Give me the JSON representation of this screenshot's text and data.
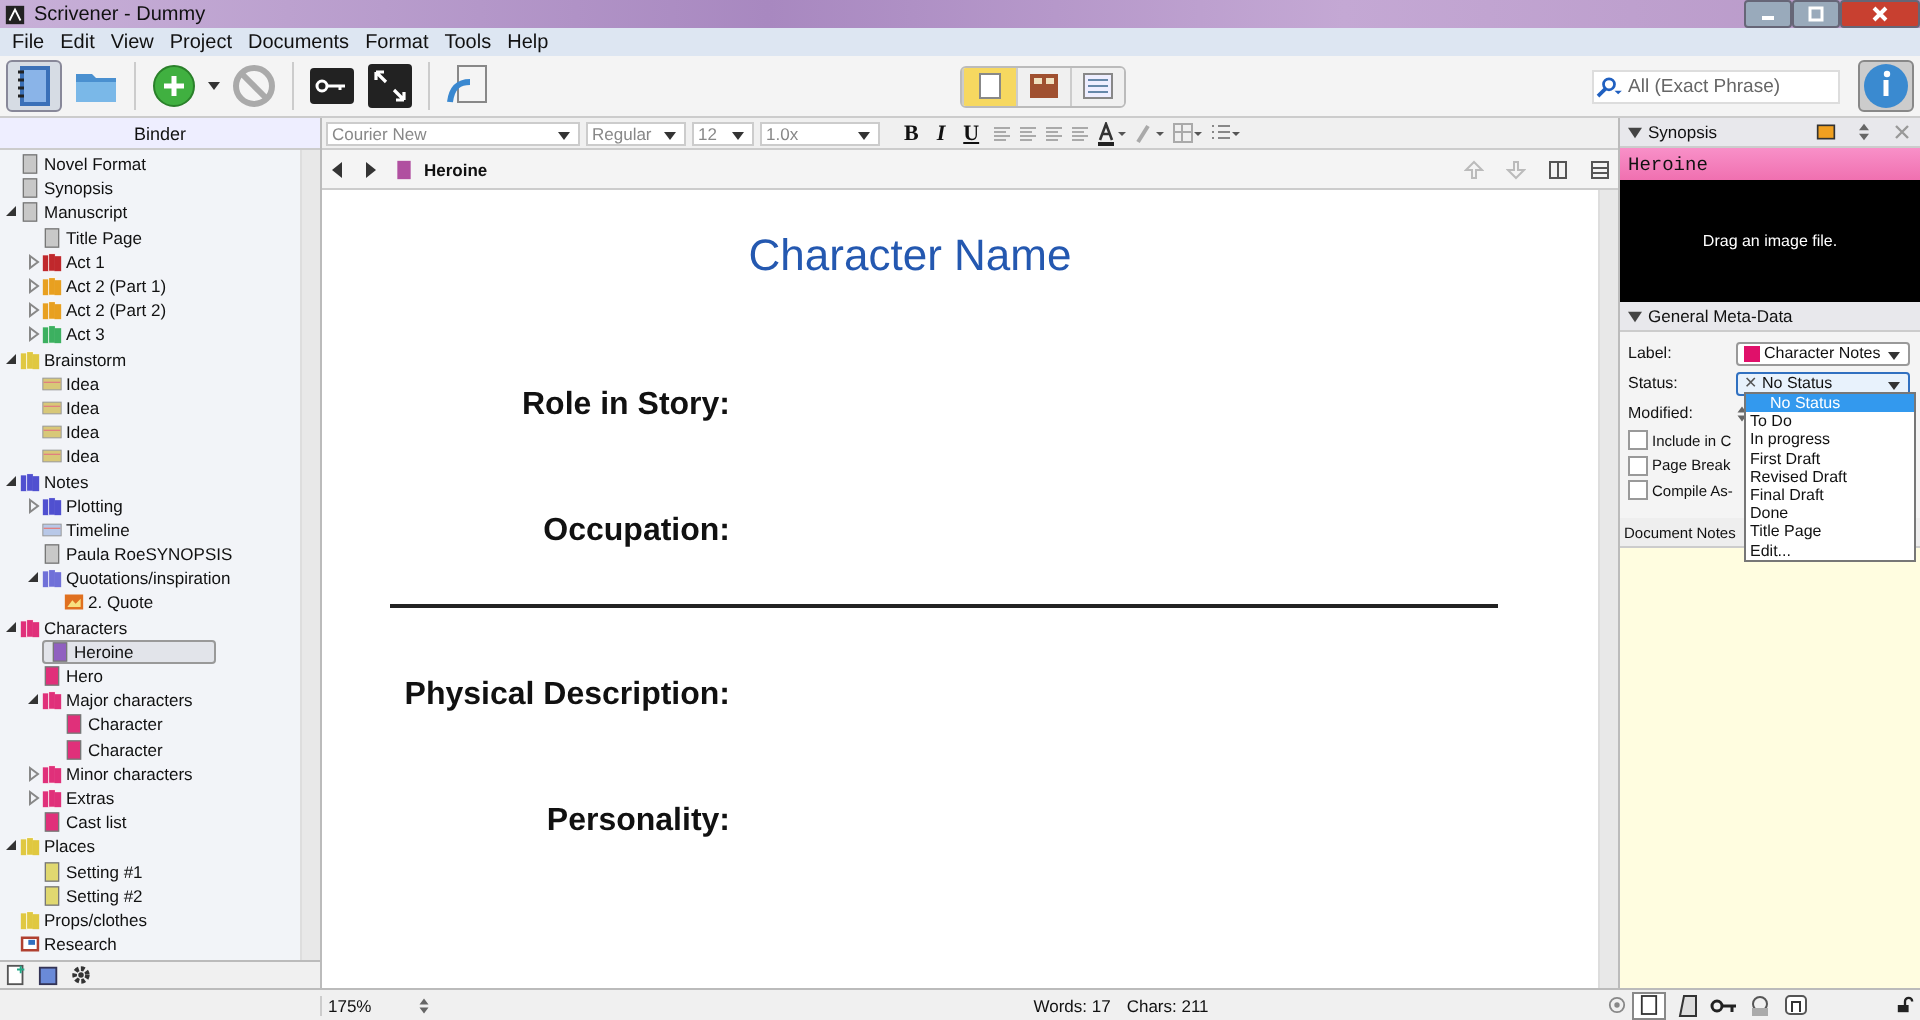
{
  "window": {
    "title": "Scrivener - Dummy"
  },
  "menu": [
    "File",
    "Edit",
    "View",
    "Project",
    "Documents",
    "Format",
    "Tools",
    "Help"
  ],
  "search": {
    "placeholder": "All (Exact Phrase)"
  },
  "view_modes": [
    {
      "selected": true
    },
    {
      "selected": false
    },
    {
      "selected": false
    }
  ],
  "format_bar": {
    "font": "Courier New",
    "style": "Regular",
    "size": "12",
    "spacing": "1.0x",
    "bold": "B",
    "italic": "I",
    "underline": "U"
  },
  "binder": {
    "title": "Binder",
    "items": [
      {
        "label": "Novel Format",
        "kind": "doc",
        "color": "#c8c8c8"
      },
      {
        "label": "Synopsis",
        "kind": "doc",
        "color": "#c8c8c8"
      },
      {
        "label": "Manuscript",
        "kind": "doc",
        "color": "#c8c8c8",
        "expanded": true,
        "children": [
          {
            "label": "Title Page",
            "kind": "doc",
            "color": "#c8c8c8"
          },
          {
            "label": "Act 1",
            "kind": "folder",
            "color": "#c0282c",
            "expanded": false
          },
          {
            "label": "Act 2 (Part 1)",
            "kind": "folder",
            "color": "#e8a020",
            "expanded": false
          },
          {
            "label": "Act 2 (Part 2)",
            "kind": "folder",
            "color": "#e8a020",
            "expanded": false
          },
          {
            "label": "Act 3",
            "kind": "folder",
            "color": "#3cb060",
            "expanded": false
          }
        ]
      },
      {
        "label": "Brainstorm",
        "kind": "folder",
        "color": "#e0c840",
        "expanded": true,
        "children": [
          {
            "label": "Idea",
            "kind": "card",
            "color": "#d8c878"
          },
          {
            "label": "Idea",
            "kind": "card",
            "color": "#d8c878"
          },
          {
            "label": "Idea",
            "kind": "card",
            "color": "#d8c878"
          },
          {
            "label": "Idea",
            "kind": "card",
            "color": "#d8c878"
          }
        ]
      },
      {
        "label": "Notes",
        "kind": "folder",
        "color": "#5050d0",
        "expanded": true,
        "children": [
          {
            "label": "Plotting",
            "kind": "folder",
            "color": "#5050d0",
            "expanded": false
          },
          {
            "label": "Timeline",
            "kind": "card",
            "color": "#b8c8e8"
          },
          {
            "label": "Paula RoeSYNOPSIS",
            "kind": "doc",
            "color": "#c8c8c8"
          },
          {
            "label": "Quotations/inspiration",
            "kind": "folder",
            "color": "#7070d8",
            "expanded": true,
            "children": [
              {
                "label": "2. Quote",
                "kind": "image",
                "color": "#e07020"
              }
            ]
          }
        ]
      },
      {
        "label": "Characters",
        "kind": "folder",
        "color": "#e0307a",
        "expanded": true,
        "children": [
          {
            "label": "Heroine",
            "kind": "doc",
            "color": "#9060c0",
            "selected": true
          },
          {
            "label": "Hero",
            "kind": "doc",
            "color": "#e0307a",
            "selected": false
          },
          {
            "label": "Major characters",
            "kind": "folder",
            "color": "#e0307a",
            "expanded": true,
            "children": [
              {
                "label": "Character",
                "kind": "doc",
                "color": "#e0307a",
                "selected": false
              },
              {
                "label": "Character",
                "kind": "doc",
                "color": "#e0307a",
                "selected": false
              }
            ]
          },
          {
            "label": "Minor characters",
            "kind": "folder",
            "color": "#e0307a",
            "expanded": false
          },
          {
            "label": "Extras",
            "kind": "folder",
            "color": "#e0307a",
            "expanded": false
          },
          {
            "label": "Cast list",
            "kind": "doc",
            "color": "#e0307a",
            "selected": false
          }
        ]
      },
      {
        "label": "Places",
        "kind": "folder",
        "color": "#e0c840",
        "expanded": true,
        "children": [
          {
            "label": "Setting #1",
            "kind": "doc",
            "color": "#e0d870"
          },
          {
            "label": "Setting #2",
            "kind": "doc",
            "color": "#e0d870"
          }
        ]
      },
      {
        "label": "Props/clothes",
        "kind": "folder",
        "color": "#e0c840"
      },
      {
        "label": "Research",
        "kind": "research",
        "color": "#b04030"
      }
    ]
  },
  "editor": {
    "document": "Heroine",
    "heading": "Character Name",
    "fields": [
      {
        "kind": "label",
        "text": "Role in Story:"
      },
      {
        "kind": "label",
        "text": "Occupation:"
      },
      {
        "kind": "rule"
      },
      {
        "kind": "label",
        "text": "Physical Description:"
      },
      {
        "kind": "label",
        "text": "Personality:"
      }
    ]
  },
  "inspector": {
    "title": "Synopsis",
    "synopsis_title": "Heroine",
    "image_hint": "Drag an image file.",
    "section": "General Meta-Data",
    "label_field": {
      "caption": "Label:",
      "value": "Character Notes",
      "color": "#e0106a"
    },
    "status_field": {
      "caption": "Status:",
      "mark": "✕",
      "value": "No Status"
    },
    "modified_caption": "Modified:",
    "checkboxes": [
      {
        "label": "Include in C",
        "checked": false
      },
      {
        "label": "Page Break",
        "checked": false
      },
      {
        "label": "Compile As-",
        "checked": false
      }
    ],
    "notes_title": "Document Notes",
    "status_options": [
      {
        "label": "No Status",
        "selected": true
      },
      {
        "label": "To Do",
        "selected": false
      },
      {
        "label": "In progress",
        "selected": false
      },
      {
        "label": "First Draft",
        "selected": false
      },
      {
        "label": "Revised Draft",
        "selected": false
      },
      {
        "label": "Final Draft",
        "selected": false
      },
      {
        "label": "Done",
        "selected": false
      },
      {
        "label": "Title Page",
        "selected": false
      },
      {
        "label": "Edit...",
        "selected": false
      }
    ]
  },
  "status_bar": {
    "zoom": "175%",
    "words": "Words: 17",
    "chars": "Chars: 211"
  }
}
